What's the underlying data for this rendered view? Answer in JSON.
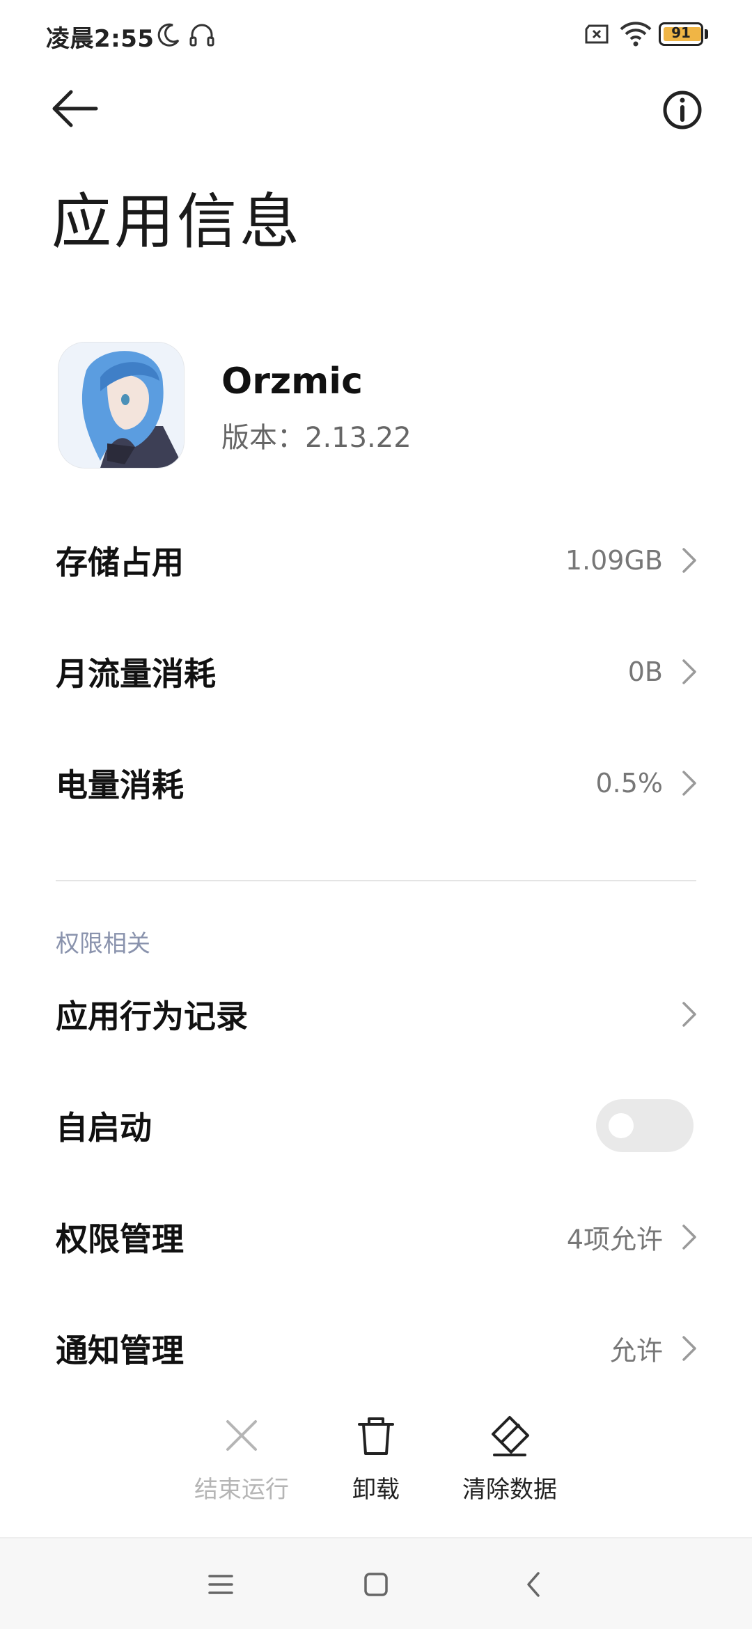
{
  "status_bar": {
    "time": "凌晨2:55",
    "battery_level": "91",
    "icons": [
      "moon-icon",
      "headset-icon",
      "sim-off-icon",
      "wifi-icon",
      "battery-icon"
    ]
  },
  "header": {
    "title": "应用信息",
    "back_icon": "arrow-left-icon",
    "info_icon": "info-icon"
  },
  "app": {
    "name": "Orzmic",
    "version": "版本：2.13.22"
  },
  "usage_rows": [
    {
      "label": "存储占用",
      "value": "1.09GB"
    },
    {
      "label": "月流量消耗",
      "value": "0B"
    },
    {
      "label": "电量消耗",
      "value": "0.5%"
    }
  ],
  "permissions": {
    "section_title": "权限相关",
    "rows": [
      {
        "label": "应用行为记录",
        "value": ""
      },
      {
        "label": "自启动",
        "toggle_on": false
      },
      {
        "label": "权限管理",
        "value": "4项允许"
      },
      {
        "label": "通知管理",
        "value": "允许"
      }
    ]
  },
  "actions": {
    "stop_label": "结束运行",
    "uninstall_label": "卸载",
    "clear_data_label": "清除数据"
  },
  "colors": {
    "accent_section": "#8a93ad",
    "battery_fill": "#f0b545",
    "toggle_off": "#e9e9e9"
  }
}
